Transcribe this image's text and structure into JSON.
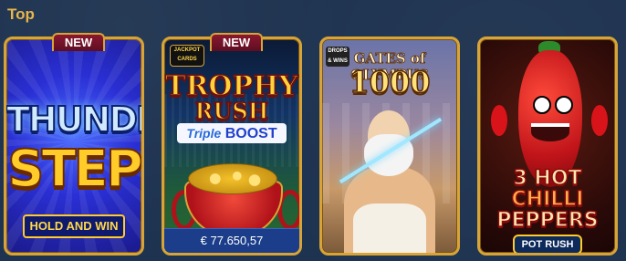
{
  "section": {
    "title": "Top"
  },
  "games": [
    {
      "name": "Thunder Step",
      "badge": "NEW",
      "title_line1": "THUNDER",
      "title_line2": "STEP",
      "tagline": "HOLD AND WIN"
    },
    {
      "name": "Trophy Rush Triple Boost",
      "badge": "NEW",
      "corner_logo": "JACKPOT CARDS",
      "title_line1": "TROPHY",
      "title_line2": "RUSH",
      "title_triple": "Triple",
      "title_boost": "BOOST",
      "jackpot_amount": "€ 77.650,57"
    },
    {
      "name": "Gates of Olympus 1000",
      "corner_logo": "DROPS & WINS",
      "title_line1": "GATES of OLYMPUS",
      "title_line2": "1000"
    },
    {
      "name": "3 Hot Chilli Peppers Pot Rush",
      "title_line1": "3 HOT",
      "title_line2": "CHILLI",
      "title_line3": "PEPPERS",
      "tagline": "POT RUSH"
    }
  ],
  "colors": {
    "background": "#1e3350",
    "section_title": "#e9b54a",
    "card_border": "#d8a437",
    "badge_bg": "#8a1830"
  }
}
